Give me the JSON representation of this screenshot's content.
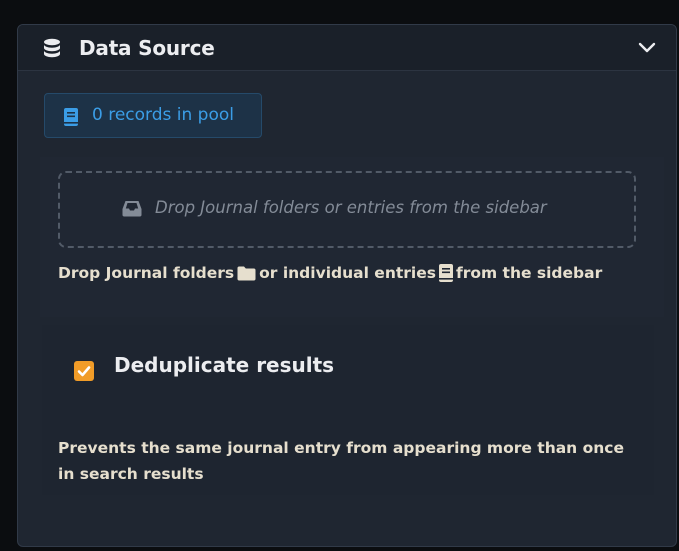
{
  "header": {
    "icon": "database-icon",
    "title": "Data Source",
    "toggle_icon": "chevron-down-icon"
  },
  "pool": {
    "icon": "book-icon",
    "label": "0 records in pool"
  },
  "drop_zone": {
    "icon": "inbox-icon",
    "placeholder": "Drop Journal folders or entries from the sidebar"
  },
  "help": {
    "part1": "Drop Journal folders",
    "folder_icon": "folder-icon",
    "part2": "or individual entries",
    "entry_icon": "journal-entry-icon",
    "part3": "from the sidebar"
  },
  "dedupe": {
    "checked": true,
    "label": "Deduplicate results",
    "description": "Prevents the same journal entry from appearing more than once in search results"
  },
  "colors": {
    "panel_bg": "#1f2631",
    "accent_blue": "#3b9de6",
    "accent_orange": "#f19c28",
    "text_light": "#ecedf0",
    "text_cream": "#e6dfce"
  }
}
